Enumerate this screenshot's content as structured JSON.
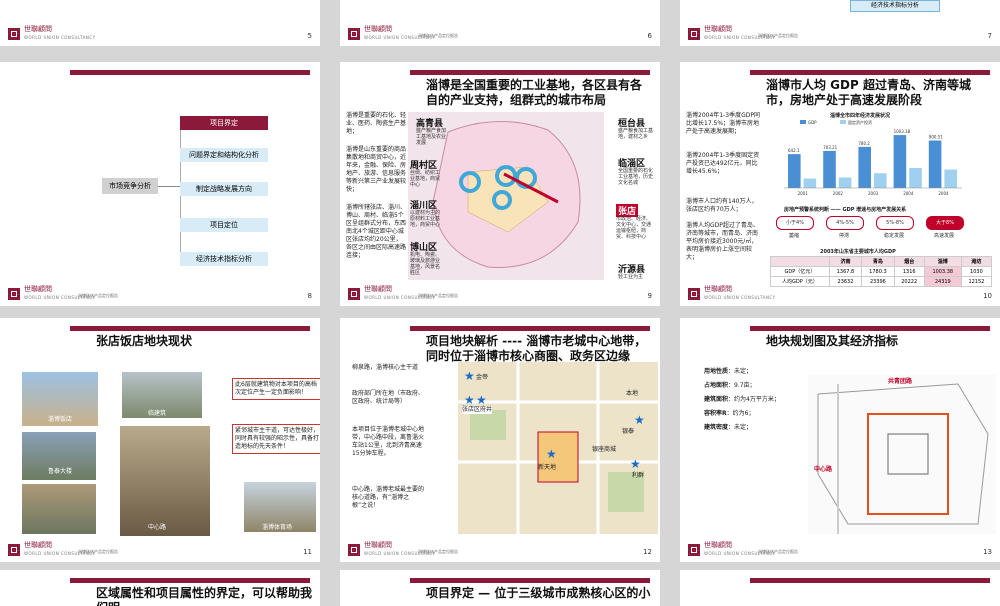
{
  "brand": {
    "name": "世聯顧問",
    "sub": "WORLD UNION CONSULTANCY",
    "doc_label": "淄博张店产品定位报告"
  },
  "colors": {
    "accent": "#8b1a3a",
    "highlight": "#c0002a",
    "box_blue": "#d8ecf8",
    "box_maroon": "#8b1a3a"
  },
  "slide5": {
    "page": "5"
  },
  "slide6": {
    "page": "6"
  },
  "slide7": {
    "page": "7",
    "tag": "经济技术指标分析"
  },
  "slide8": {
    "page": "8",
    "left_box": "市场竞争分析",
    "steps": [
      "项目界定",
      "问题界定和结构化分析",
      "制定战略发展方向",
      "项目定位",
      "经济技术指标分析"
    ]
  },
  "slide9": {
    "page": "9",
    "title": "淄博是全国重要的工业基地，各区县有各自的产业支持，组群式的城市布局",
    "bullets": [
      "淄博是重要的石化、轻业、医药、陶瓷生产基地；",
      "淄博是山东重要的商品集散地和商贸中心，近年来，金融、保险、房地产、旅游、信息服务等新兴第三产业发展较快；",
      "淄博所辖张店、淄川、博山、周村、临淄5个区呈组群式分布，东西南北4个城区距中心城区张店均约20公里，各区之间由区际高速路连接；"
    ],
    "bullet3_highlight": "各区之间由区际高速路连接；",
    "districts": [
      {
        "name": "高青县",
        "note": "盛产粮产食加工基地及农业发展"
      },
      {
        "name": "周村区",
        "note": "丝绸、纺织工业基地，商贸中心"
      },
      {
        "name": "淄川区",
        "note": "以建材为主的原材料工业基地，商贸中心"
      },
      {
        "name": "博山区",
        "note": "机电、陶瓷、玻璃及旅游业基地，风景名胜区"
      },
      {
        "name": "桓台县",
        "note": "盛产粮食加工基地，建材之乡"
      },
      {
        "name": "临淄区",
        "note": "全国重要的石化工业基地，历史文化名城"
      },
      {
        "name": "张店",
        "note": "市政治、经济、文化中心，交通运输枢纽，商贸、科技中心"
      },
      {
        "name": "沂源县",
        "note": "轻工业为主"
      }
    ]
  },
  "slide10": {
    "page": "10",
    "title": "淄博市人均 GDP 超过青岛、济南等城市，房地产处于高速发展阶段",
    "bullets": [
      "淄博2004年1-3季度GDP同比增长17.5%；淄博市房地产处于高速发展期；",
      "淄博2004年1-3季度固定资产投资已达492亿元，同比增长45.6%；",
      "淄博市人口约有140万人，张店区约有70万人；",
      "淄博人均GDP超过了青岛、济南等城市，而青岛、济南平均房价接近3000元/㎡，表明淄博房价上涨空间较大；"
    ],
    "chart_title": "淄博全市四年经济发展状况",
    "stages_title": "房地产预警系统判断 —— GDP 增速与房地产发展关系",
    "stages": [
      {
        "range": "小于4%",
        "label": "萎缩"
      },
      {
        "range": "4%-5%",
        "label": "停滞"
      },
      {
        "range": "5%-8%",
        "label": "稳定发展"
      },
      {
        "range": "大于8%",
        "label": "高速发展"
      }
    ],
    "table_title": "2003年山东省主要城市人均GDP",
    "table_headers": [
      "",
      "济南",
      "青岛",
      "烟台",
      "淄博",
      "潍坊"
    ],
    "table_rows": [
      [
        "GDP（亿元）",
        "1367.8",
        "1780.3",
        "1316",
        "1003.38",
        "1030"
      ],
      [
        "人均GDP（元）",
        "23632",
        "23396",
        "20222",
        "24319",
        "12152"
      ]
    ]
  },
  "chart_data": {
    "type": "bar",
    "title": "淄博全市四年经济发展状况",
    "categories": [
      "2001",
      "2002",
      "2003",
      "2004",
      "2004"
    ],
    "series": [
      {
        "name": "GDP",
        "values": [
          642.1,
          703.21,
          780.2,
          1003.38,
          900.51
        ]
      },
      {
        "name": "固定资产投资",
        "values": [
          180,
          200,
          280,
          380,
          350
        ]
      }
    ],
    "ylim": [
      0,
      1100
    ]
  },
  "slide11": {
    "page": "11",
    "title": "张店饭店地块现状",
    "captions": [
      "淄博饭店",
      "临建筑",
      "鲁泰大楼",
      "中心路",
      "淄博体育场"
    ],
    "notes": [
      "此6层就建筑物对本项目的高档次定位产生一定负面影响！",
      "紧邻城市主干道，可达性极好，同时具有较强的昭示性，具备打造地标的先天条件！"
    ]
  },
  "slide12": {
    "page": "12",
    "title": "项目地块解析 ---- 淄博市老城中心地带，同时位于淄博市核心商圈、政务区边缘",
    "notes": [
      "柳泉路，淄博核心主干道",
      "政府部门所在地（市政府、区政府、统计局等）",
      "本项目位于淄博老城中心地带，中心路中段，离鲁淄火车站1公里，北到济青高速15分钟车程。",
      "中心路，淄博老城最主要的核心道路，有“淄博之根”之说！"
    ],
    "map_labels": [
      "金帝",
      "张店区府井",
      "本地",
      "银泰",
      "银座商城",
      "新天地",
      "利群"
    ]
  },
  "slide13": {
    "page": "13",
    "title": "地块规划图及其经济指标",
    "indicators": [
      {
        "label": "用地性质",
        "value": "：未定；"
      },
      {
        "label": "占地面积",
        "value": "：9.7亩；"
      },
      {
        "label": "建筑面积",
        "value": "：约为4万平方米；"
      },
      {
        "label": "容积率R",
        "value": "：约为6；"
      },
      {
        "label": "建筑密度",
        "value": "：未定；"
      }
    ],
    "road_labels": [
      "共青团路",
      "中心路"
    ]
  },
  "slide14": {
    "title": "区域属性和项目属性的界定，可以帮助我们明"
  },
  "slide15": {
    "title": "项目界定 — 位于三级城市成熟核心区的小"
  },
  "slide16": {}
}
